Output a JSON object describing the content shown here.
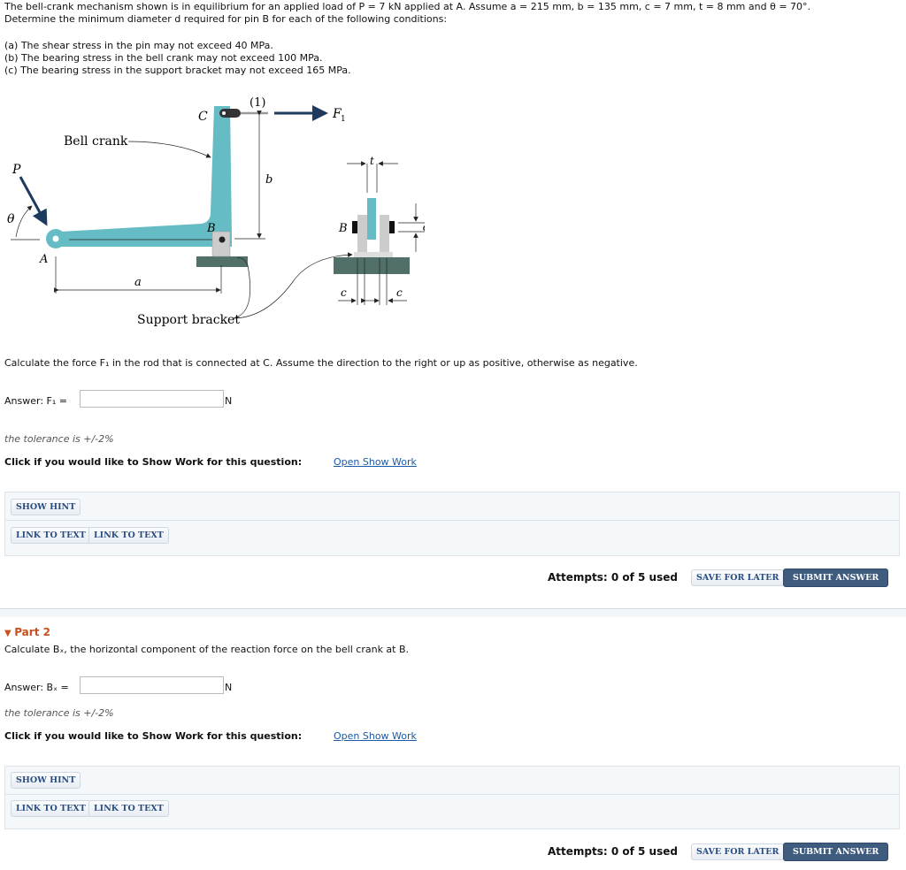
{
  "problem": {
    "line1": "The bell-crank mechanism shown is in equilibrium for an applied load of P = 7 kN applied at A. Assume a = 215 mm, b = 135 mm, c = 7 mm, t = 8 mm and θ = 70°.",
    "line2": "Determine the minimum diameter d required for pin B for each of the following conditions:",
    "conditions": [
      "(a) The shear stress in the pin may not exceed 40 MPa.",
      "(b) The bearing stress in the bell crank may not exceed 100 MPa.",
      "(c) The bearing stress in the support bracket may not exceed 165 MPa."
    ]
  },
  "figure": {
    "C": "C",
    "one": "(1)",
    "F1": "F",
    "F1sub": "1",
    "bell_crank": "Bell crank",
    "P": "P",
    "theta": "θ",
    "A": "A",
    "B": "B",
    "b": "b",
    "a": "a",
    "support_bracket": "Support bracket",
    "t": "t",
    "d": "d",
    "c": "c",
    "B2": "B",
    "teal": "#65bcc4",
    "base": "#52706a"
  },
  "part1": {
    "question": "Calculate the force F₁ in the rod that is connected at C. Assume the direction to the right or up as positive, otherwise as negative.",
    "answer_label": "Answer: F₁ =",
    "answer_value": "",
    "unit": "N",
    "tolerance": "the tolerance is +/-2%",
    "show_work_prompt": "Click if you would like to Show Work for this question:",
    "show_work_link": "Open Show Work",
    "show_hint": "SHOW HINT",
    "link1": "LINK TO TEXT",
    "link2": "LINK TO TEXT",
    "attempts": "Attempts: 0 of 5 used",
    "save": "SAVE FOR LATER",
    "submit": "SUBMIT ANSWER"
  },
  "part2": {
    "title": "Part 2",
    "question": "Calculate Bₓ, the horizontal component of the reaction force on the bell crank at B.",
    "answer_label": "Answer: Bₓ =",
    "answer_value": "",
    "unit": "N",
    "tolerance": "the tolerance is +/-2%",
    "show_work_prompt": "Click if you would like to Show Work for this question:",
    "show_work_link": "Open Show Work",
    "show_hint": "SHOW HINT",
    "link1": "LINK TO TEXT",
    "link2": "LINK TO TEXT",
    "attempts": "Attempts: 0 of 5 used",
    "save": "SAVE FOR LATER",
    "submit": "SUBMIT ANSWER"
  }
}
